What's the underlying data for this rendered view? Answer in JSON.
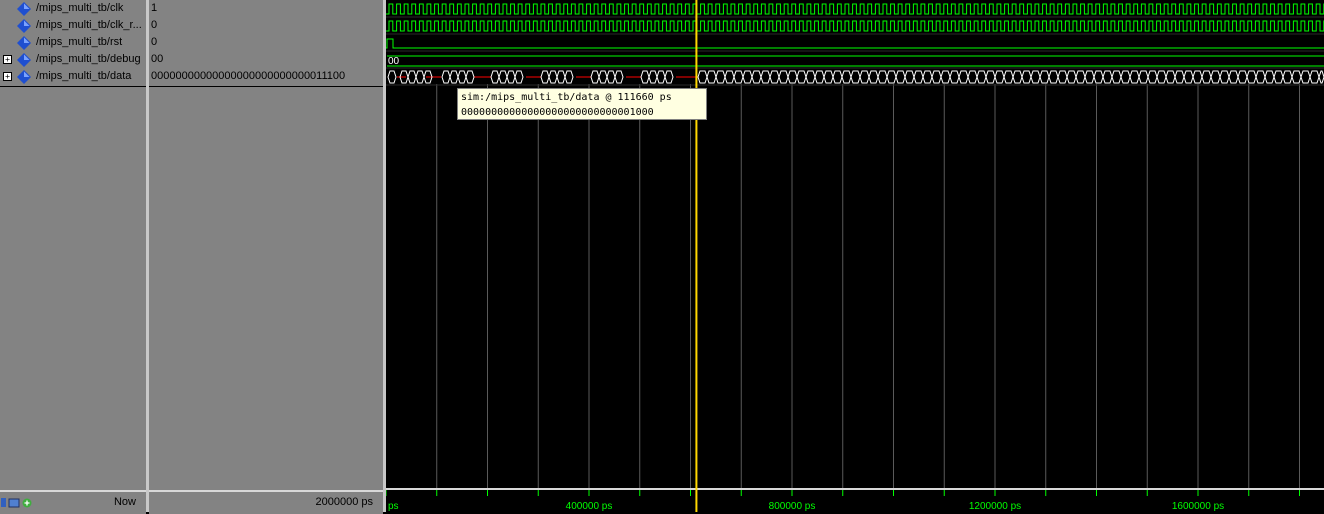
{
  "signals": [
    {
      "name": "/mips_multi_tb/clk",
      "value": "1",
      "expandable": false
    },
    {
      "name": "/mips_multi_tb/clk_r...",
      "value": "0",
      "expandable": false
    },
    {
      "name": "/mips_multi_tb/rst",
      "value": "0",
      "expandable": false
    },
    {
      "name": "/mips_multi_tb/debug",
      "value": "00",
      "expandable": true
    },
    {
      "name": "/mips_multi_tb/data",
      "value": "00000000000000000000000000011100",
      "expandable": true
    }
  ],
  "footer": {
    "now_label": "Now",
    "now_value": "2000000 ps"
  },
  "wave": {
    "debug_label": "00",
    "time_axis_labels": [
      "ps",
      "400000 ps",
      "800000 ps",
      "1200000 ps",
      "1600000 ps"
    ],
    "cursor_time_ps": 611660
  },
  "tooltip": {
    "line1": "sim:/mips_multi_tb/data @ 111660 ps",
    "line2": "00000000000000000000000000001000"
  },
  "colors": {
    "wave_green": "#00ff00",
    "grid": "#4d4d4d",
    "cursor": "#ffd700",
    "bus_invalid": "#ff0000",
    "axis_text": "#00ff00"
  },
  "icons": {
    "signal": "blue-diamond",
    "expand": "plus-box"
  }
}
